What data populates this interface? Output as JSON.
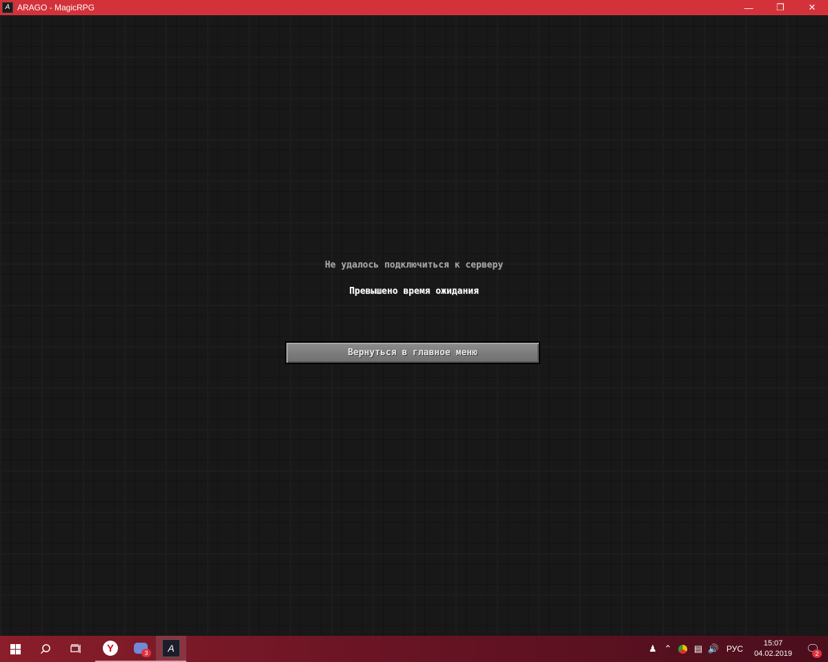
{
  "window": {
    "title": "ARAGO - MagicRPG",
    "controls": {
      "minimize": "—",
      "maximize": "❐",
      "close": "✕"
    }
  },
  "dialog": {
    "title": "Не удалось подключиться к серверу",
    "reason": "Превышено время ожидания",
    "button_label": "Вернуться в главное меню"
  },
  "taskbar": {
    "apps": [
      {
        "name": "yandex-browser",
        "icon_text": "Y"
      },
      {
        "name": "discord",
        "badge": "3"
      },
      {
        "name": "arago",
        "icon_text": "A"
      }
    ],
    "tray": {
      "language": "РУС",
      "time": "15:07",
      "date": "04.02.2019",
      "notifications_badge": "2"
    }
  },
  "colors": {
    "titlebar": "#d4323a",
    "taskbar": "#6a1424",
    "button": "#7d7d7d"
  }
}
